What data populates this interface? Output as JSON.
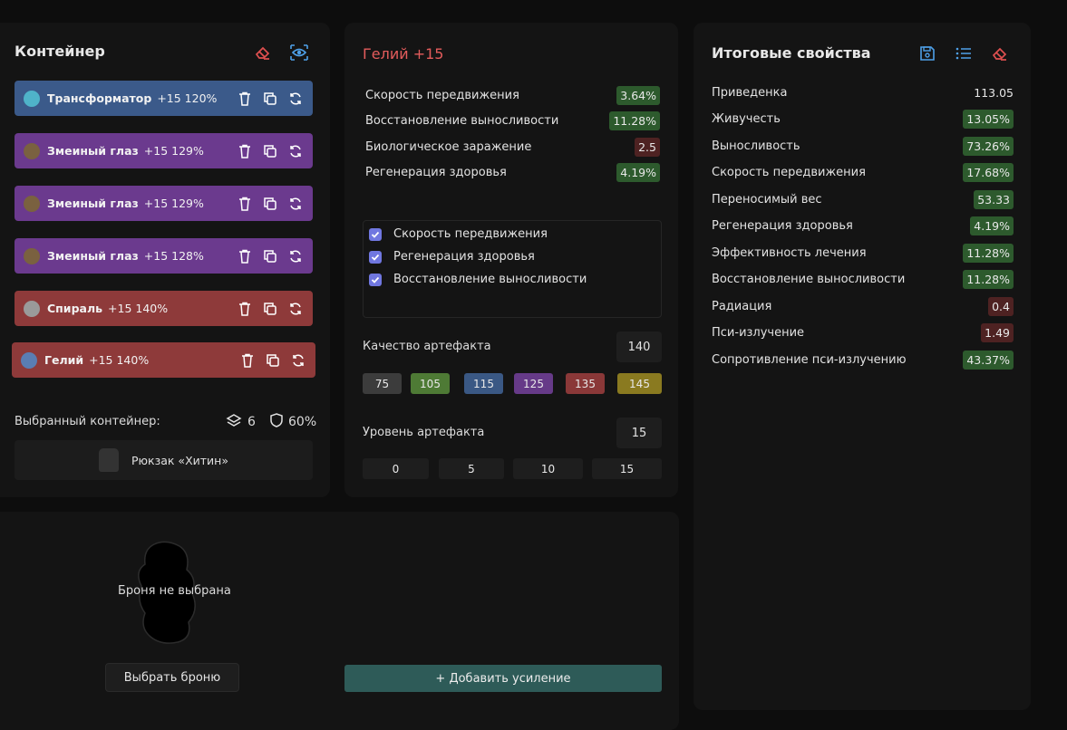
{
  "container": {
    "title": "Контейнер",
    "artifacts": [
      {
        "name": "Трансформатор",
        "meta": "+15  120%",
        "color": "blue",
        "thumb": "#4fb3c9"
      },
      {
        "name": "Змеиный глаз",
        "meta": "+15  129%",
        "color": "purple",
        "thumb": "#7a6140"
      },
      {
        "name": "Змеиный глаз",
        "meta": "+15  129%",
        "color": "purple",
        "thumb": "#7a6140"
      },
      {
        "name": "Змеиный глаз",
        "meta": "+15  128%",
        "color": "purple",
        "thumb": "#7a6140"
      },
      {
        "name": "Спираль",
        "meta": "+15  140%",
        "color": "red",
        "thumb": "#9a9a9a"
      },
      {
        "name": "Гелий",
        "meta": "+15  140%",
        "color": "red",
        "thumb": "#5a7db3"
      }
    ],
    "selected_label": "Выбранный контейнер:",
    "slots": "6",
    "protection": "60%",
    "backpack": "Рюкзак «Хитин»"
  },
  "artifact_detail": {
    "title": "Гелий +15",
    "stats": [
      {
        "label": "Скорость передвижения",
        "value": "3.64%",
        "tone": "green"
      },
      {
        "label": "Восстановление выносливости",
        "value": "11.28%",
        "tone": "green"
      },
      {
        "label": "Биологическое заражение",
        "value": "2.5",
        "tone": "darkred"
      },
      {
        "label": "Регенерация здоровья",
        "value": "4.19%",
        "tone": "green"
      }
    ],
    "checkboxes": [
      {
        "label": "Скорость передвижения",
        "checked": true
      },
      {
        "label": "Регенерация здоровья",
        "checked": true
      },
      {
        "label": "Восстановление выносливости",
        "checked": true
      }
    ],
    "quality_label": "Качество артефакта",
    "quality_value": "140",
    "quality_presets": [
      {
        "label": "75",
        "color": "#3c3c3c"
      },
      {
        "label": "105",
        "color": "#4e7a35"
      },
      {
        "label": "115",
        "color": "#3a5884"
      },
      {
        "label": "125",
        "color": "#663a88"
      },
      {
        "label": "135",
        "color": "#8a3838"
      },
      {
        "label": "145",
        "color": "#8a7a20"
      }
    ],
    "level_label": "Уровень артефакта",
    "level_value": "15",
    "level_presets": [
      "0",
      "5",
      "10",
      "15"
    ]
  },
  "armor": {
    "empty_text": "Броня не выбрана",
    "select_button": "Выбрать броню",
    "add_boost_button": "+ Добавить усиление"
  },
  "summary": {
    "title": "Итоговые свойства",
    "rows": [
      {
        "label": "Приведенка",
        "value": "113.05",
        "tone": "plain"
      },
      {
        "label": "Живучесть",
        "value": "13.05%",
        "tone": "green"
      },
      {
        "label": "Выносливость",
        "value": "73.26%",
        "tone": "green"
      },
      {
        "label": "Скорость передвижения",
        "value": "17.68%",
        "tone": "green"
      },
      {
        "label": "Переносимый вес",
        "value": "53.33",
        "tone": "green"
      },
      {
        "label": "Регенерация здоровья",
        "value": "4.19%",
        "tone": "green"
      },
      {
        "label": "Эффективность лечения",
        "value": "11.28%",
        "tone": "green"
      },
      {
        "label": "Восстановление выносливости",
        "value": "11.28%",
        "tone": "green"
      },
      {
        "label": "Радиация",
        "value": "0.4",
        "tone": "darkred"
      },
      {
        "label": "Пси-излучение",
        "value": "1.49",
        "tone": "darkred"
      },
      {
        "label": "Сопротивление пси-излучению",
        "value": "43.37%",
        "tone": "green"
      }
    ]
  }
}
